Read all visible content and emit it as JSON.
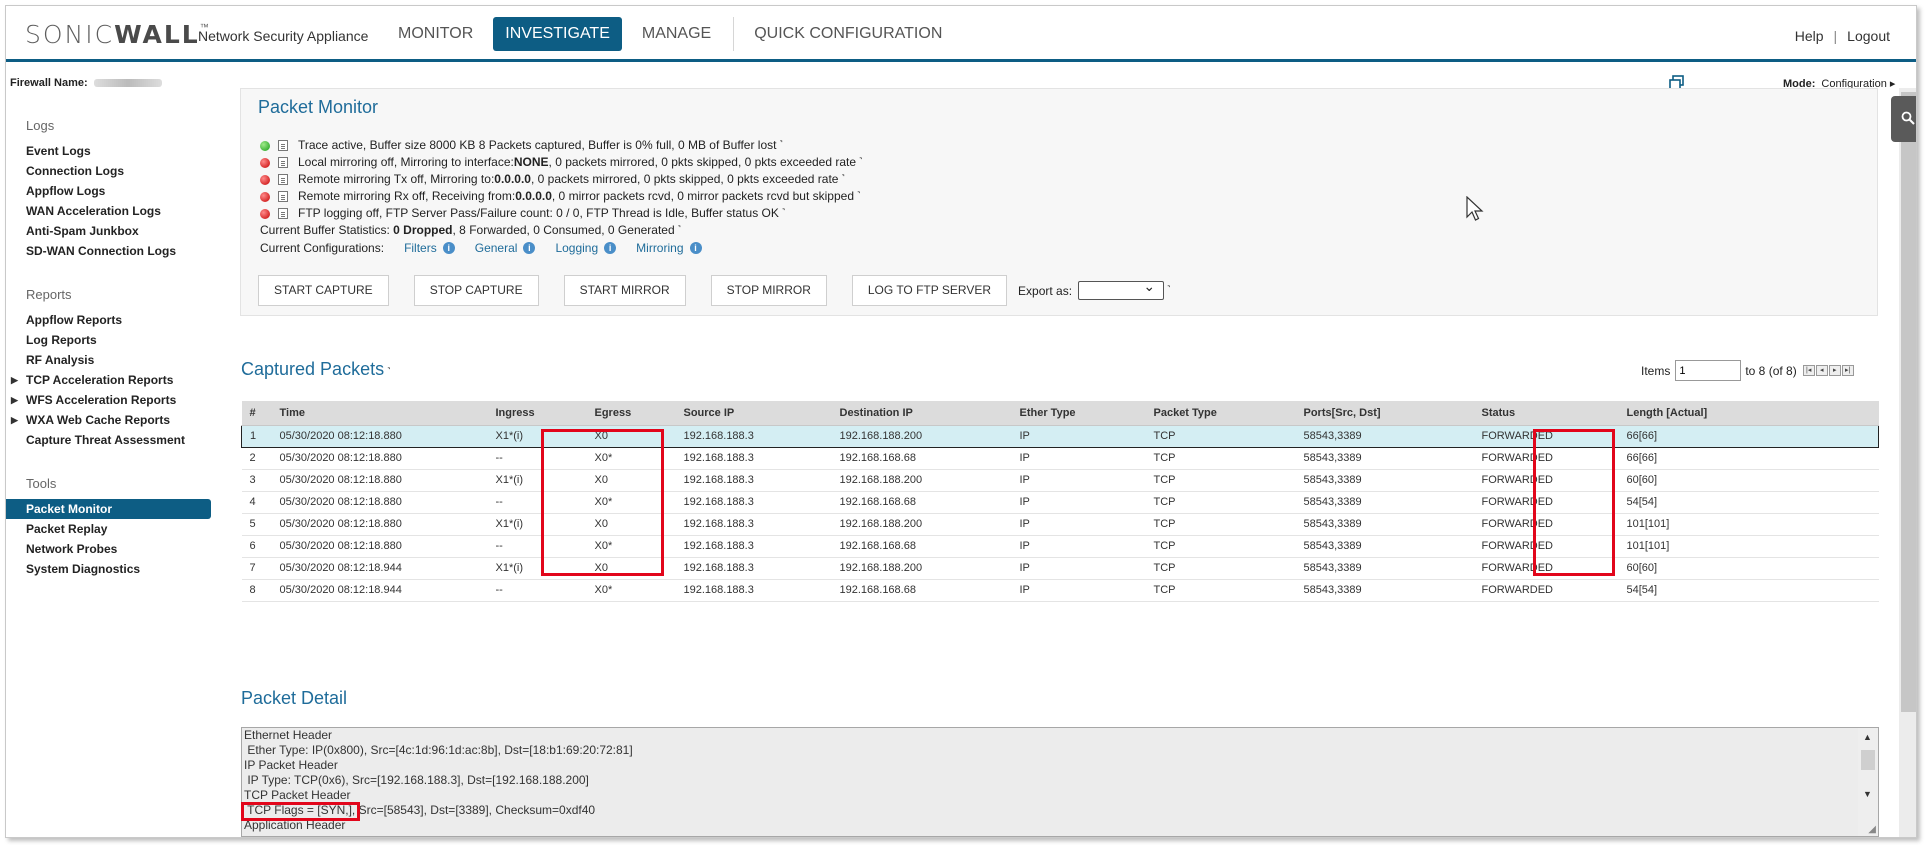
{
  "brand": {
    "logo_light": "SONIC",
    "logo_bold": "WALL",
    "logo_tm": "™",
    "product": "Network Security Appliance"
  },
  "nav": {
    "tabs": [
      "MONITOR",
      "INVESTIGATE",
      "MANAGE",
      "QUICK CONFIGURATION"
    ],
    "active": "INVESTIGATE"
  },
  "toplinks": {
    "help": "Help",
    "sep": "|",
    "logout": "Logout"
  },
  "firewall": {
    "label": "Firewall Name:"
  },
  "mode": {
    "label": "Mode:",
    "value": "Configuration ▸"
  },
  "sidebar": {
    "logs": {
      "heading": "Logs",
      "items": [
        "Event Logs",
        "Connection Logs",
        "Appflow Logs",
        "WAN Acceleration Logs",
        "Anti-Spam Junkbox",
        "SD-WAN Connection Logs"
      ]
    },
    "reports": {
      "heading": "Reports",
      "items": [
        "Appflow Reports",
        "Log Reports",
        "RF Analysis",
        "TCP Acceleration Reports",
        "WFS Acceleration Reports",
        "WXA Web Cache Reports",
        "Capture Threat Assessment"
      ]
    },
    "tools": {
      "heading": "Tools",
      "items": [
        "Packet Monitor",
        "Packet Replay",
        "Network Probes",
        "System Diagnostics"
      ],
      "active": "Packet Monitor"
    }
  },
  "packet_monitor": {
    "title": "Packet Monitor",
    "status_lines": [
      {
        "color": "green",
        "text": "Trace active,   Buffer size 8000 KB  8 Packets captured,   Buffer is 0% full,   0 MB of Buffer lost"
      },
      {
        "color": "red",
        "text": "Local mirroring off,   Mirroring to interface:",
        "bold": "NONE",
        "text2": ",   0 packets mirrored,   0 pkts skipped,   0 pkts exceeded rate"
      },
      {
        "color": "red",
        "text": "Remote mirroring Tx off,   Mirroring to: ",
        "bold": "0.0.0.0",
        "text2": ",   0 packets mirrored,   0 pkts skipped,   0 pkts exceeded rate"
      },
      {
        "color": "red",
        "text": "Remote mirroring Rx off,   Receiving from: ",
        "bold": "0.0.0.0",
        "text2": ",   0 mirror packets rcvd,   0 mirror packets rcvd but skipped"
      },
      {
        "color": "red",
        "text": "FTP logging off,   FTP Server Pass/Failure count: 0 / 0,   FTP Thread is Idle,   Buffer status OK"
      }
    ],
    "buffer_stats": {
      "label": "Current Buffer Statistics: ",
      "bold": "0 Dropped",
      "rest": ", 8 Forwarded, 0 Consumed, 0 Generated"
    },
    "configs": {
      "label": "Current Configurations:",
      "links": [
        "Filters",
        "General",
        "Logging",
        "Mirroring"
      ]
    },
    "buttons": [
      "START CAPTURE",
      "STOP CAPTURE",
      "START MIRROR",
      "STOP MIRROR",
      "LOG TO FTP SERVER"
    ],
    "export_label": "Export as:"
  },
  "captured": {
    "title": "Captured Packets",
    "items_label": "Items",
    "items_value": "1",
    "items_range": "to 8 (of 8)",
    "columns": [
      "#",
      "Time",
      "Ingress",
      "Egress",
      "Source IP",
      "Destination IP",
      "Ether Type",
      "Packet Type",
      "Ports[Src, Dst]",
      "Status",
      "Length [Actual]"
    ],
    "rows": [
      [
        "1",
        "05/30/2020 08:12:18.880",
        "X1*(i)",
        "X0",
        "192.168.188.3",
        "192.168.188.200",
        "IP",
        "TCP",
        "58543,3389",
        "FORWARDED",
        "66[66]"
      ],
      [
        "2",
        "05/30/2020 08:12:18.880",
        "--",
        "X0*",
        "192.168.188.3",
        "192.168.168.68",
        "IP",
        "TCP",
        "58543,3389",
        "FORWARDED",
        "66[66]"
      ],
      [
        "3",
        "05/30/2020 08:12:18.880",
        "X1*(i)",
        "X0",
        "192.168.188.3",
        "192.168.188.200",
        "IP",
        "TCP",
        "58543,3389",
        "FORWARDED",
        "60[60]"
      ],
      [
        "4",
        "05/30/2020 08:12:18.880",
        "--",
        "X0*",
        "192.168.188.3",
        "192.168.168.68",
        "IP",
        "TCP",
        "58543,3389",
        "FORWARDED",
        "54[54]"
      ],
      [
        "5",
        "05/30/2020 08:12:18.880",
        "X1*(i)",
        "X0",
        "192.168.188.3",
        "192.168.188.200",
        "IP",
        "TCP",
        "58543,3389",
        "FORWARDED",
        "101[101]"
      ],
      [
        "6",
        "05/30/2020 08:12:18.880",
        "--",
        "X0*",
        "192.168.188.3",
        "192.168.168.68",
        "IP",
        "TCP",
        "58543,3389",
        "FORWARDED",
        "101[101]"
      ],
      [
        "7",
        "05/30/2020 08:12:18.944",
        "X1*(i)",
        "X0",
        "192.168.188.3",
        "192.168.188.200",
        "IP",
        "TCP",
        "58543,3389",
        "FORWARDED",
        "60[60]"
      ],
      [
        "8",
        "05/30/2020 08:12:18.944",
        "--",
        "X0*",
        "192.168.188.3",
        "192.168.168.68",
        "IP",
        "TCP",
        "58543,3389",
        "FORWARDED",
        "54[54]"
      ]
    ]
  },
  "detail": {
    "title": "Packet Detail",
    "lines": [
      "Ethernet Header",
      " Ether Type: IP(0x800), Src=[4c:1d:96:1d:ac:8b], Dst=[18:b1:69:20:72:81]",
      "IP Packet Header",
      " IP Type: TCP(0x6), Src=[192.168.188.3], Dst=[192.168.188.200]",
      "TCP Packet Header",
      " TCP Flags = [SYN,], Src=[58543], Dst=[3389], Checksum=0xdf40",
      "Application Header"
    ]
  },
  "colors": {
    "brand_blue": "#0d5d84",
    "title_blue": "#1f6c9a",
    "highlight_red": "#e2061b",
    "selected_row": "#d4eef3"
  }
}
